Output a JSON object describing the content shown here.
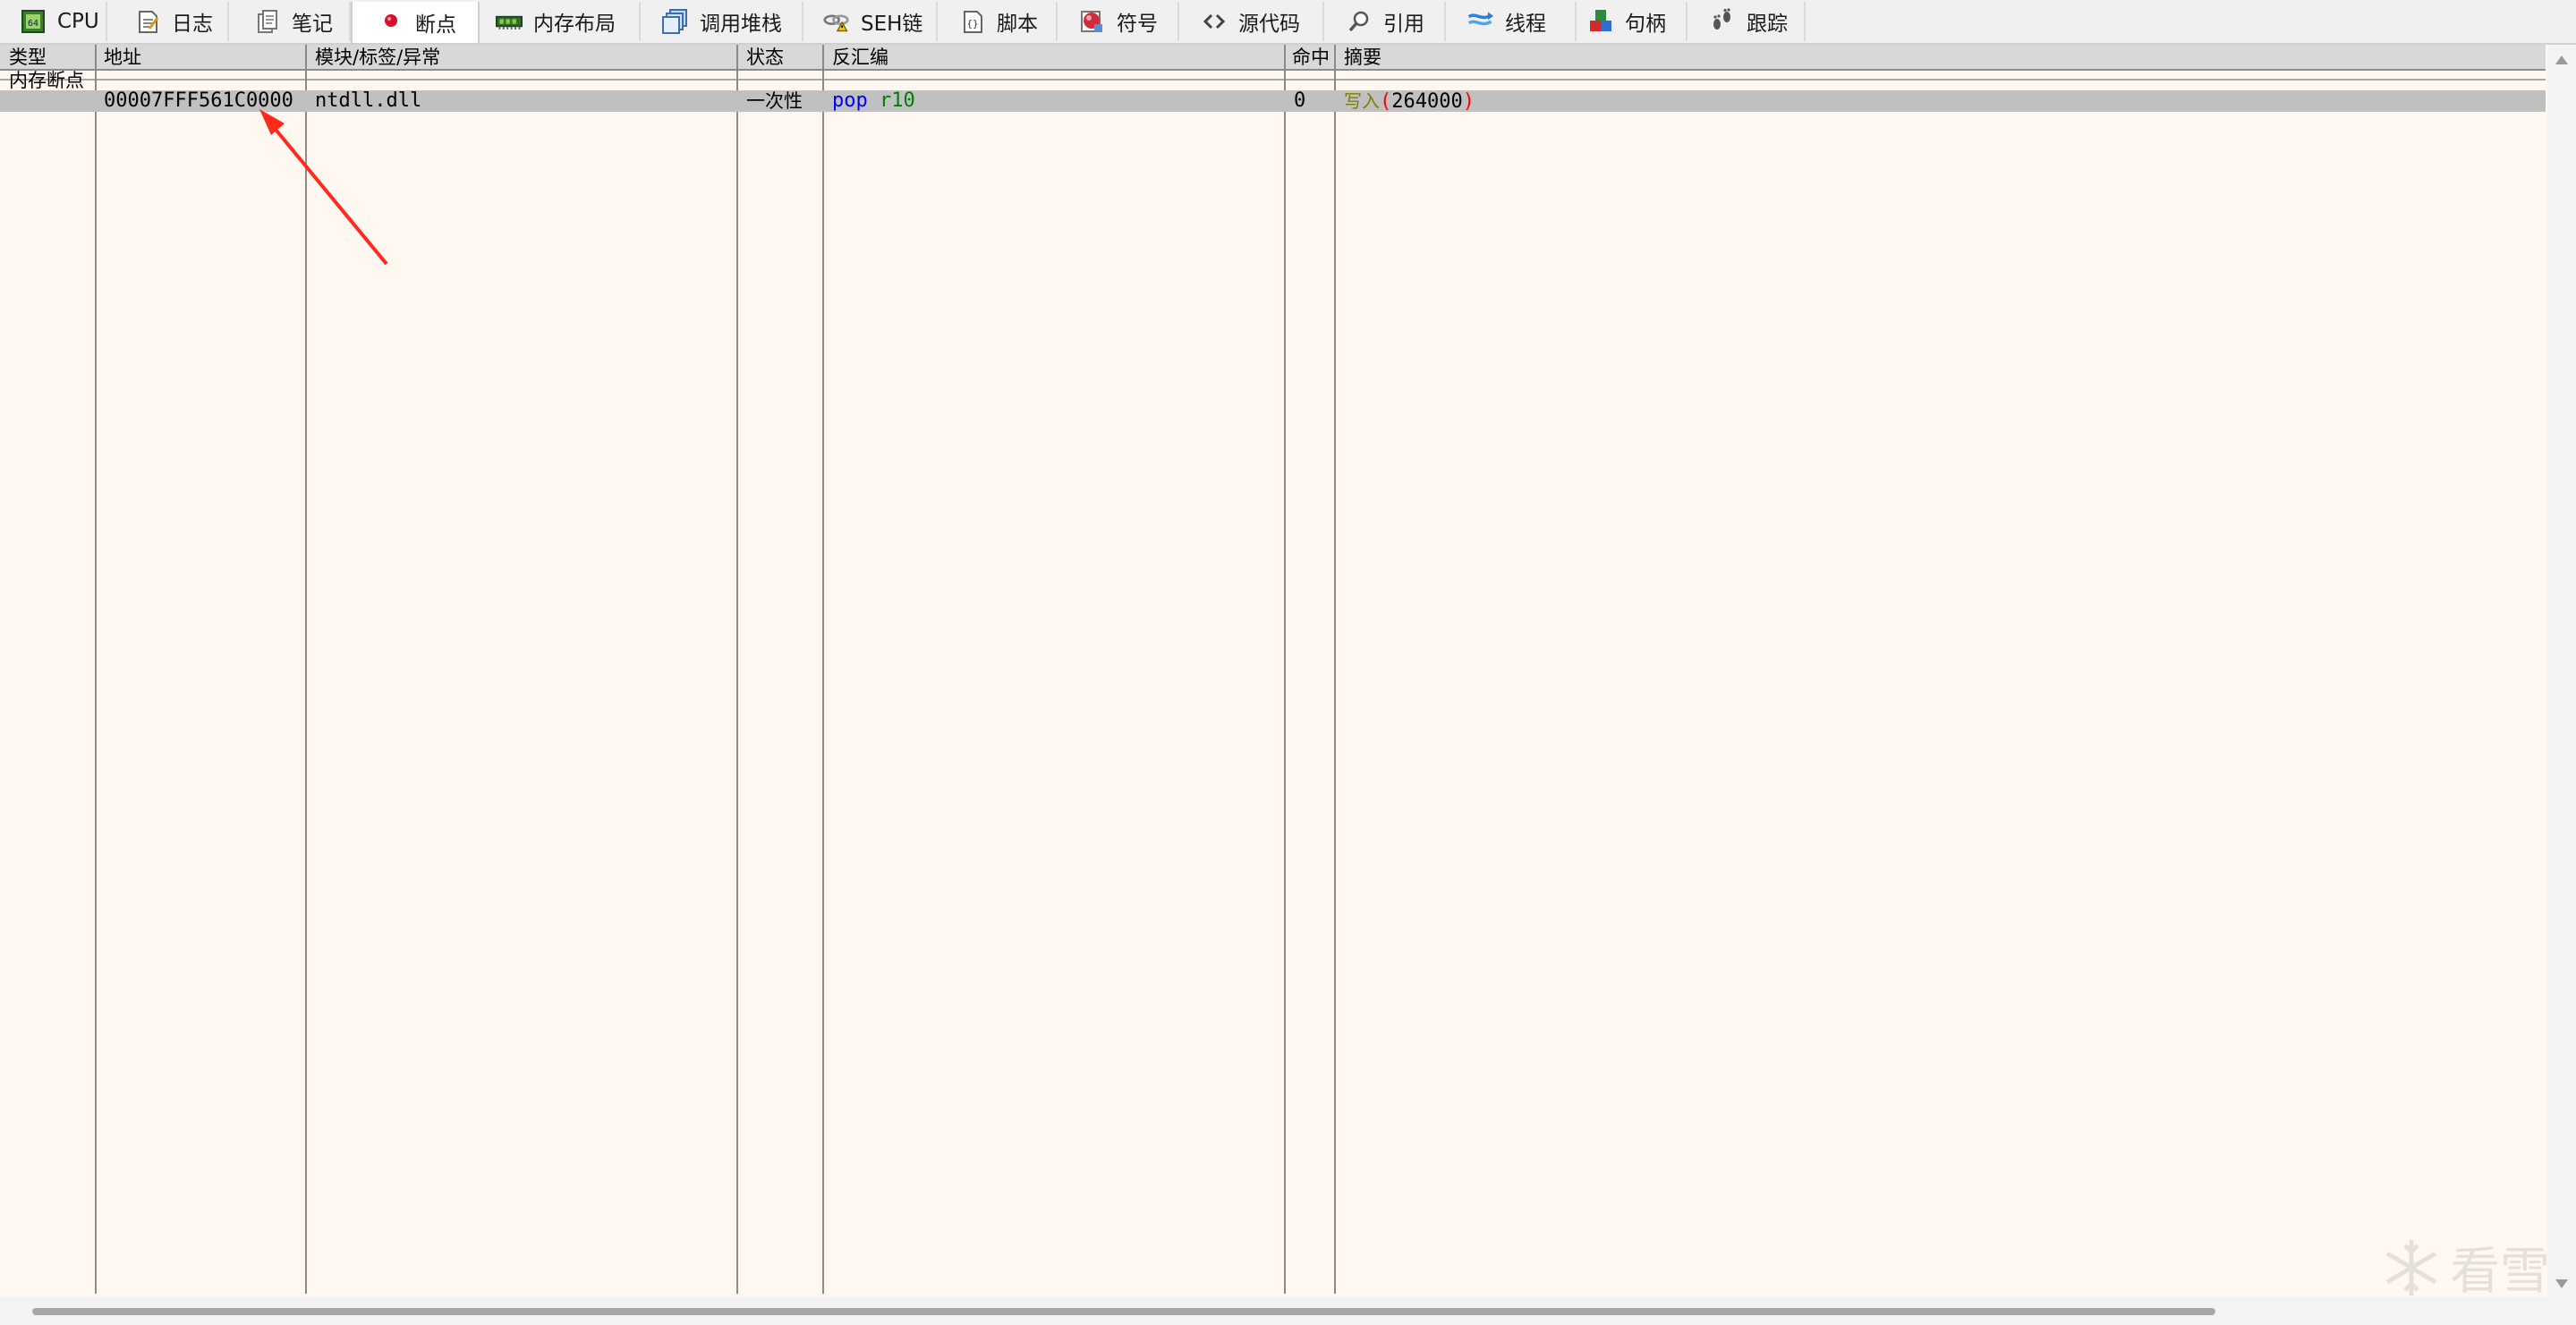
{
  "tabs": [
    {
      "label": "CPU",
      "icon": "cpu-icon",
      "active": false
    },
    {
      "label": "日志",
      "icon": "log-icon",
      "active": false
    },
    {
      "label": "笔记",
      "icon": "notes-icon",
      "active": false
    },
    {
      "label": "断点",
      "icon": "breakpoint-icon",
      "active": true
    },
    {
      "label": "内存布局",
      "icon": "memory-map-icon",
      "active": false
    },
    {
      "label": "调用堆栈",
      "icon": "call-stack-icon",
      "active": false
    },
    {
      "label": "SEH链",
      "icon": "seh-chain-icon",
      "active": false
    },
    {
      "label": "脚本",
      "icon": "script-icon",
      "active": false
    },
    {
      "label": "符号",
      "icon": "symbols-icon",
      "active": false
    },
    {
      "label": "源代码",
      "icon": "source-icon",
      "active": false
    },
    {
      "label": "引用",
      "icon": "references-icon",
      "active": false
    },
    {
      "label": "线程",
      "icon": "threads-icon",
      "active": false
    },
    {
      "label": "句柄",
      "icon": "handles-icon",
      "active": false
    },
    {
      "label": "跟踪",
      "icon": "trace-icon",
      "active": false
    }
  ],
  "table": {
    "columns": [
      "类型",
      "地址",
      "模块/标签/异常",
      "状态",
      "反汇编",
      "命中",
      "摘要"
    ],
    "group_label": "内存断点",
    "rows": [
      {
        "address": "00007FFF561C0000",
        "module": "ntdll.dll",
        "state": "一次性",
        "disasm_mnemonic": "pop",
        "disasm_operand": "r10",
        "hits": "0",
        "summary_prefix": "写入",
        "summary_open": "(",
        "summary_value": "264000",
        "summary_close": ")"
      }
    ]
  },
  "watermark": "看雪",
  "colors": {
    "background": "#FFF8F0",
    "header": "#D8D8D8",
    "selected_row": "#C0C0C0",
    "mnemonic": "#0000FF",
    "register": "#008000",
    "summary_prefix": "#808000",
    "paren": "#FF0000",
    "annotation_arrow": "#FF2A1A"
  }
}
